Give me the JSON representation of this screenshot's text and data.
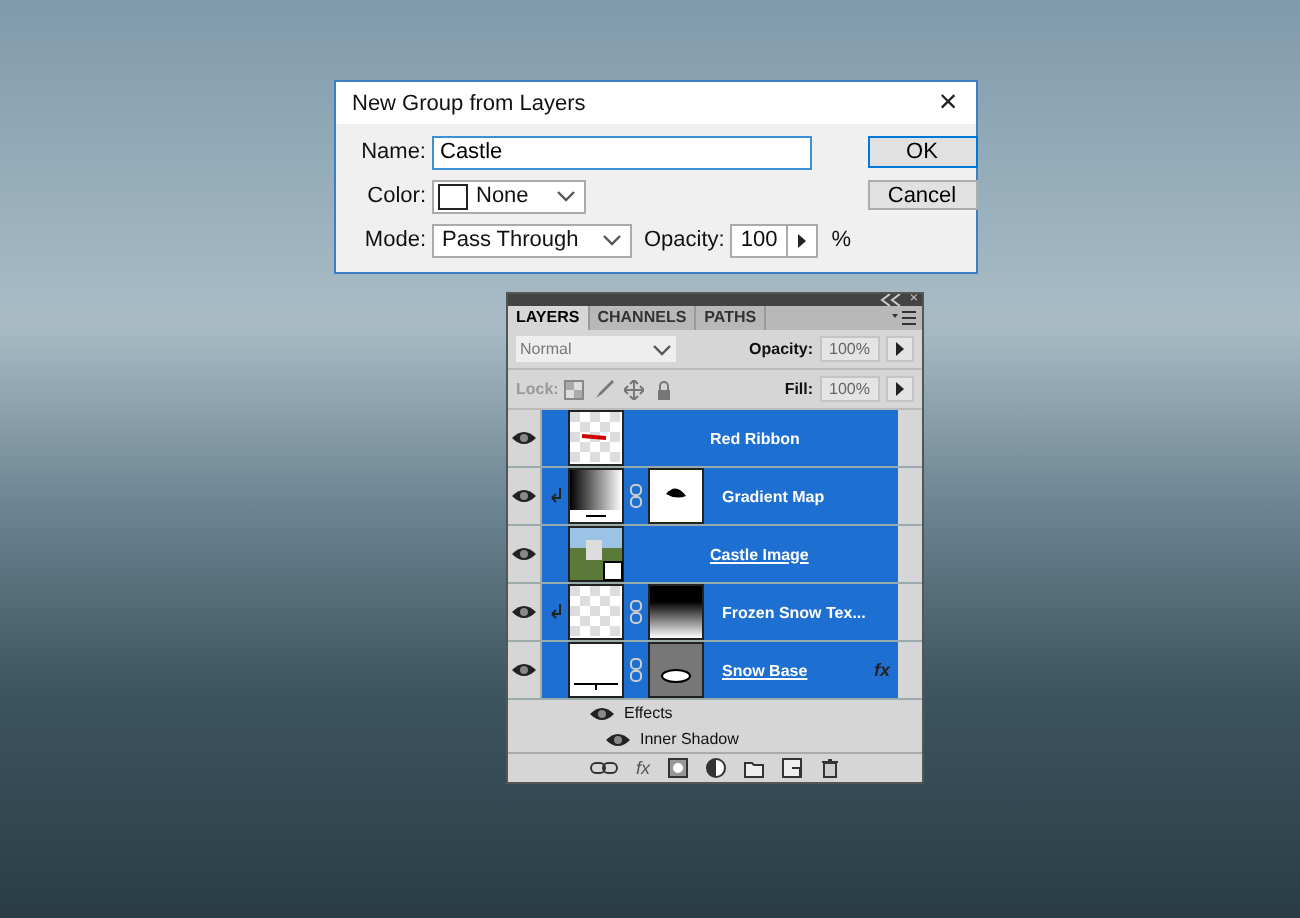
{
  "dialog": {
    "title": "New Group from Layers",
    "close": "×",
    "fields": [
      {
        "kind": "text",
        "label": "Name:",
        "value": "Castle"
      },
      {
        "kind": "color",
        "label": "Color:",
        "value": "None"
      },
      {
        "kind": "mode",
        "label": "Mode:",
        "value": "Pass Through",
        "opacity_label": "Opacity:",
        "opacity": "100",
        "unit": "%"
      }
    ],
    "buttons": [
      {
        "label": "OK",
        "default": true
      },
      {
        "label": "Cancel",
        "default": false
      }
    ]
  },
  "layers_panel": {
    "close": "×",
    "tabs": [
      {
        "label": "LAYERS",
        "selected": true
      },
      {
        "label": "CHANNELS",
        "selected": false
      },
      {
        "label": "PATHS",
        "selected": false
      }
    ],
    "blend_mode": "Normal",
    "opacity_label": "Opacity:",
    "opacity": "100%",
    "lock_label": "Lock:",
    "fill_label": "Fill:",
    "fill": "100%",
    "layers": [
      {
        "name": "Red Ribbon",
        "kind": "pixel",
        "selected": true,
        "visible": true,
        "clipped": false,
        "linked": false
      },
      {
        "name": "Gradient Map",
        "kind": "adjustment",
        "selected": true,
        "visible": true,
        "clipped": true,
        "linked": false
      },
      {
        "name": "Castle Image",
        "kind": "smart",
        "selected": true,
        "visible": true,
        "clipped": false,
        "linked": true
      },
      {
        "name": "Frozen Snow Tex...",
        "kind": "masked",
        "selected": true,
        "visible": true,
        "clipped": true,
        "linked": false
      },
      {
        "name": "Snow Base",
        "kind": "shape",
        "selected": true,
        "visible": true,
        "clipped": false,
        "linked": true,
        "fx_badge": "fx",
        "children": [
          {
            "name": "Effects",
            "visible": true
          },
          {
            "name": "Inner Shadow",
            "visible": true
          }
        ]
      }
    ],
    "footer_fx": "fx"
  }
}
